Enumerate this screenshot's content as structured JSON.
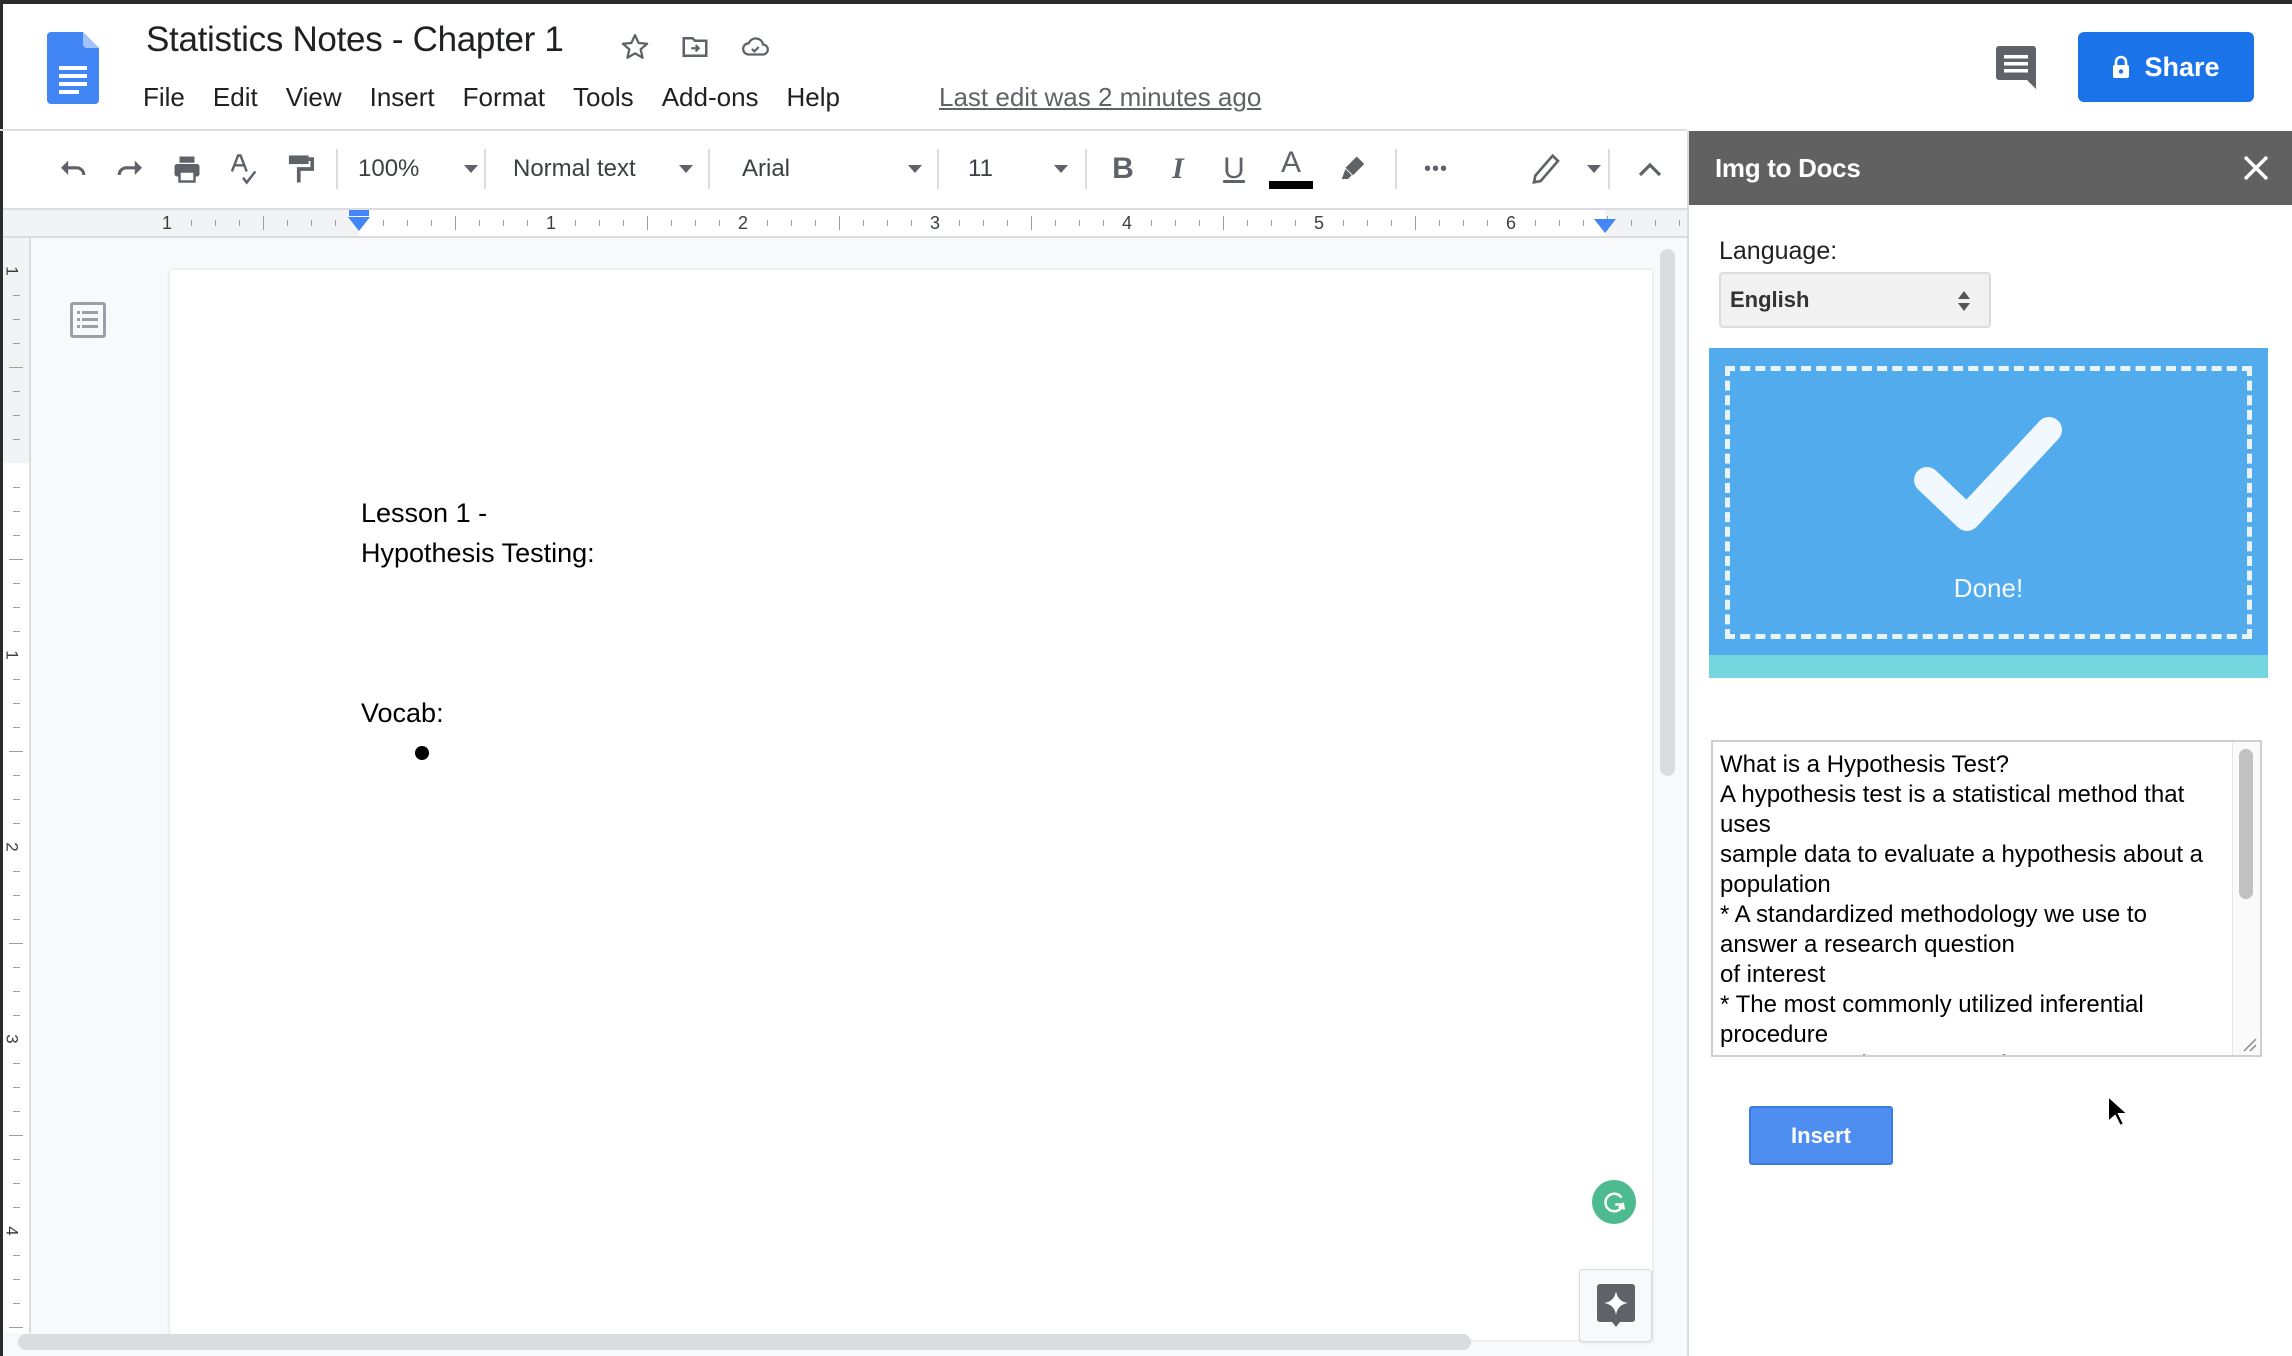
{
  "app": {
    "title": "Statistics Notes - Chapter 1",
    "last_edit": "Last edit was 2 minutes ago",
    "share_label": "Share",
    "brand_color": "#1a73e8"
  },
  "menu": [
    "File",
    "Edit",
    "View",
    "Insert",
    "Format",
    "Tools",
    "Add-ons",
    "Help"
  ],
  "toolbar": {
    "zoom": "100%",
    "style": "Normal text",
    "font": "Arial",
    "font_size": "11",
    "bold_label": "B",
    "italic_label": "I",
    "underline_label": "U",
    "text_color_label": "A",
    "text_color": "#000000",
    "more_label": "•••"
  },
  "ruler": {
    "h_labels": [
      "1",
      "1",
      "2",
      "3",
      "4",
      "5",
      "6"
    ],
    "v_labels": [
      "1",
      "1",
      "2",
      "3",
      "4"
    ]
  },
  "document": {
    "lines": [
      "Lesson 1 -",
      "Hypothesis Testing:",
      "Vocab:"
    ]
  },
  "side_panel": {
    "title": "Img to Docs",
    "language_label": "Language:",
    "language_selected": "English",
    "status_label": "Done!",
    "progress": 1.0,
    "dropzone_color": "#51abec",
    "progress_color": "#75d6df",
    "result_text": "What is a Hypothesis Test?\nA hypothesis test is a statistical method that uses\nsample data to evaluate a hypothesis about a population\n* A standardized methodology we use to answer a research question\nof interest\n* The most commonly utilized inferential procedure\n* Lays out a rigorous set of",
    "insert_label": "Insert"
  }
}
